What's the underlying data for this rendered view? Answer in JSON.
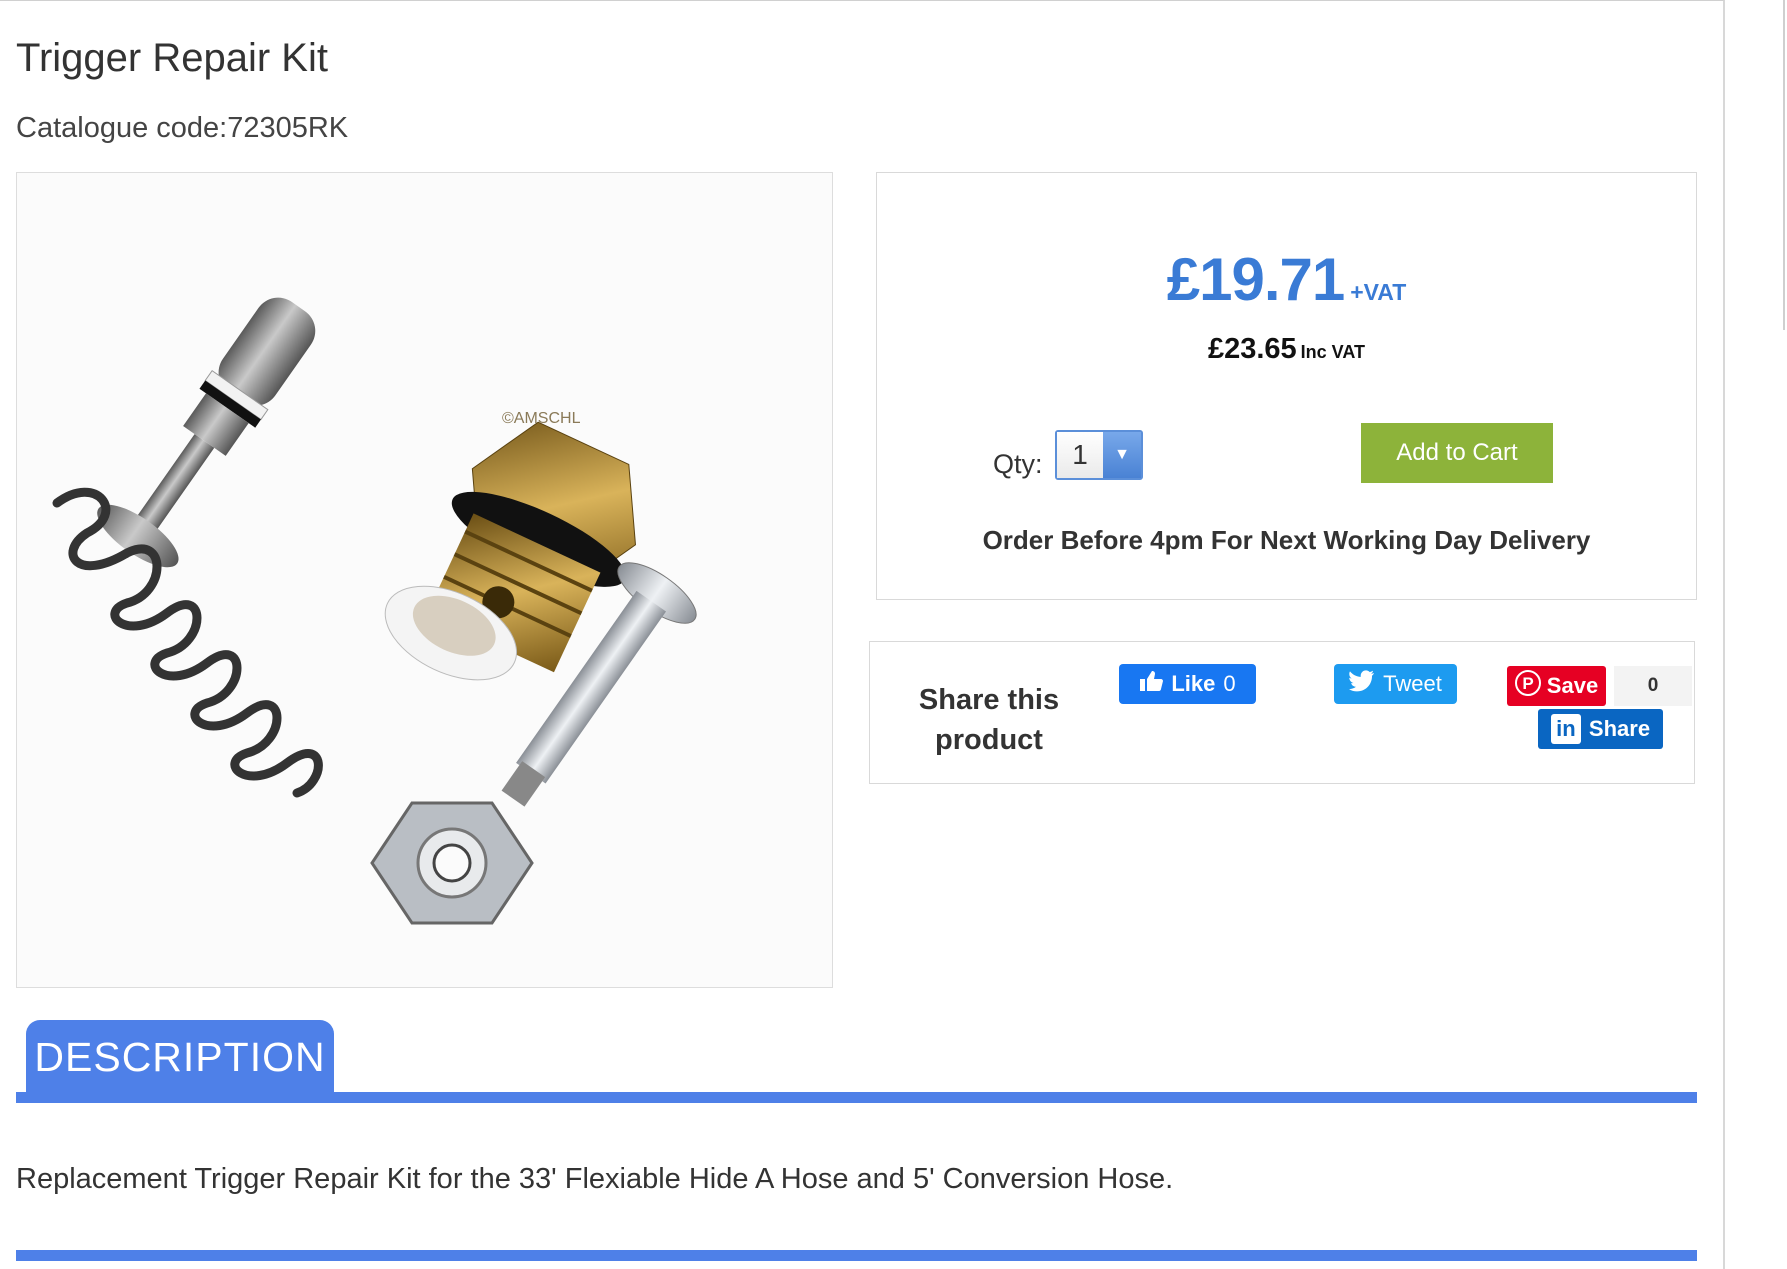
{
  "product": {
    "title": "Trigger Repair Kit",
    "catalogue": "Catalogue code:72305RK",
    "image_watermark": "©AMSCHL"
  },
  "pricing": {
    "price_ex_vat": "£19.71",
    "ex_vat_suffix": "+VAT",
    "price_inc_vat": "£23.65",
    "inc_vat_suffix": "Inc VAT",
    "qty_label": "Qty:",
    "qty_value": "1",
    "add_to_cart_label": "Add to Cart",
    "delivery_note": "Order Before 4pm For Next Working Day Delivery",
    "accent_color": "#3a7bd5",
    "cart_button_color": "#8db33a"
  },
  "share": {
    "label": "Share this product",
    "facebook": {
      "label": "Like",
      "count": "0"
    },
    "twitter": {
      "label": "Tweet"
    },
    "pinterest": {
      "label": "Save",
      "count": "0"
    },
    "linkedin": {
      "label": "Share"
    }
  },
  "description": {
    "tab_label": "DESCRIPTION",
    "text": "Replacement Trigger Repair Kit for the 33' Flexiable Hide A Hose and 5' Conversion Hose.",
    "tab_color": "#4e80e8"
  }
}
